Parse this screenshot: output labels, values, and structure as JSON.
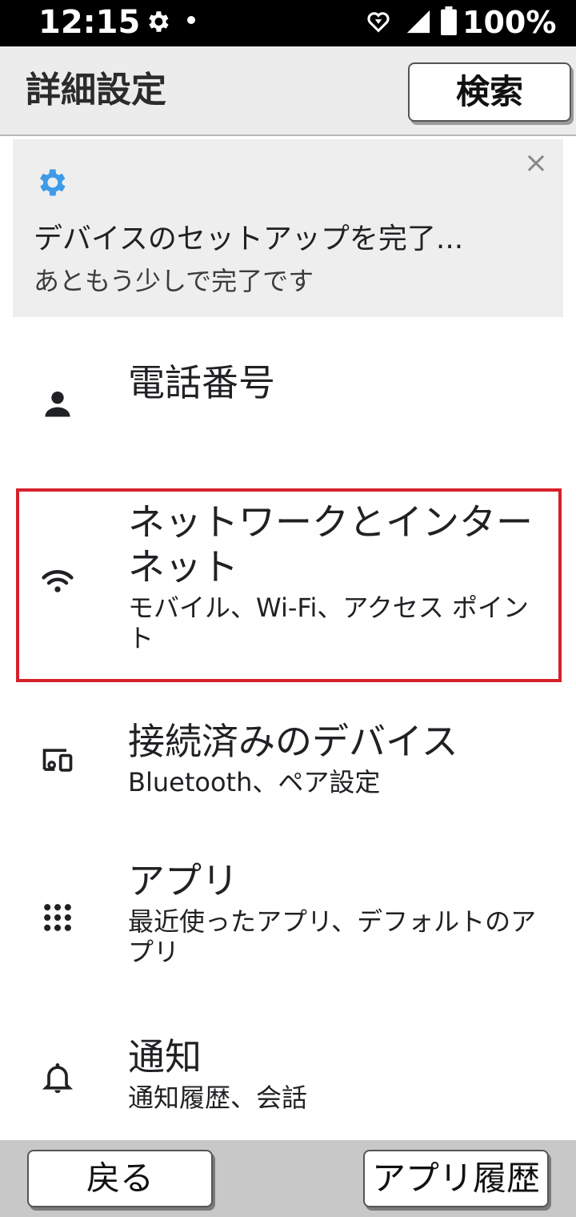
{
  "status_bar": {
    "time": "12:15",
    "battery": "100%"
  },
  "app_bar": {
    "title": "詳細設定",
    "search_label": "検索"
  },
  "setup_card": {
    "title": "デバイスのセットアップを完了...",
    "subtitle": "あともう少しで完了です",
    "close_icon": "×",
    "accent_color": "#3d9be9"
  },
  "items": [
    {
      "icon": "person-icon",
      "label": "電話番号",
      "sub": ""
    },
    {
      "icon": "wifi-icon",
      "label": "ネットワークとインターネット",
      "sub": "モバイル、Wi-Fi、アクセス ポイント"
    },
    {
      "icon": "connected-devices-icon",
      "label": "接続済みのデバイス",
      "sub": "Bluetooth、ペア設定"
    },
    {
      "icon": "apps-grid-icon",
      "label": "アプリ",
      "sub": "最近使ったアプリ、デフォルトのアプリ"
    },
    {
      "icon": "bell-icon",
      "label": "通知",
      "sub": "通知履歴、会話"
    }
  ],
  "bottom_bar": {
    "back_label": "戻る",
    "history_label": "アプリ履歴"
  },
  "highlight_color": "#d6202a"
}
